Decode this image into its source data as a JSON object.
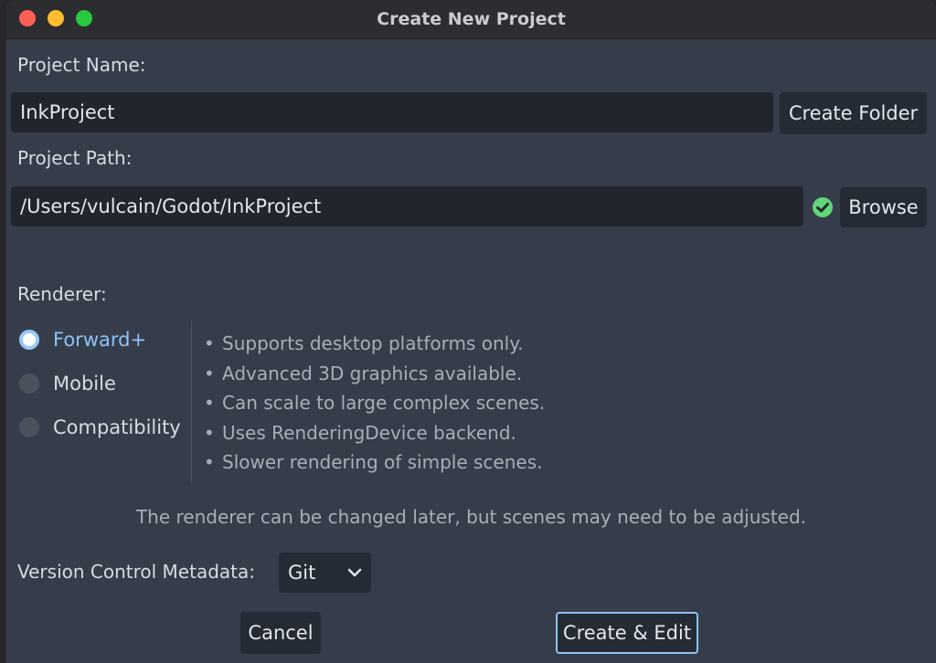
{
  "window": {
    "title": "Create New Project"
  },
  "project_name": {
    "label": "Project Name:",
    "value": "InkProject",
    "create_folder_label": "Create Folder"
  },
  "project_path": {
    "label": "Project Path:",
    "value": "/Users/vulcain/Godot/InkProject",
    "status_icon": "check-circle-icon",
    "browse_label": "Browse"
  },
  "renderer": {
    "label": "Renderer:",
    "options": [
      {
        "label": "Forward+",
        "selected": true
      },
      {
        "label": "Mobile",
        "selected": false
      },
      {
        "label": "Compatibility",
        "selected": false
      }
    ],
    "features": [
      "Supports desktop platforms only.",
      "Advanced 3D graphics available.",
      "Can scale to large complex scenes.",
      "Uses RenderingDevice backend.",
      "Slower rendering of simple scenes."
    ],
    "note": "The renderer can be changed later, but scenes may need to be adjusted."
  },
  "vcs": {
    "label": "Version Control Metadata:",
    "selected": "Git"
  },
  "footer": {
    "cancel_label": "Cancel",
    "create_label": "Create & Edit"
  },
  "colors": {
    "accent": "#8fc2f4",
    "valid": "#5fd77a",
    "window_bg": "#363d4a"
  }
}
